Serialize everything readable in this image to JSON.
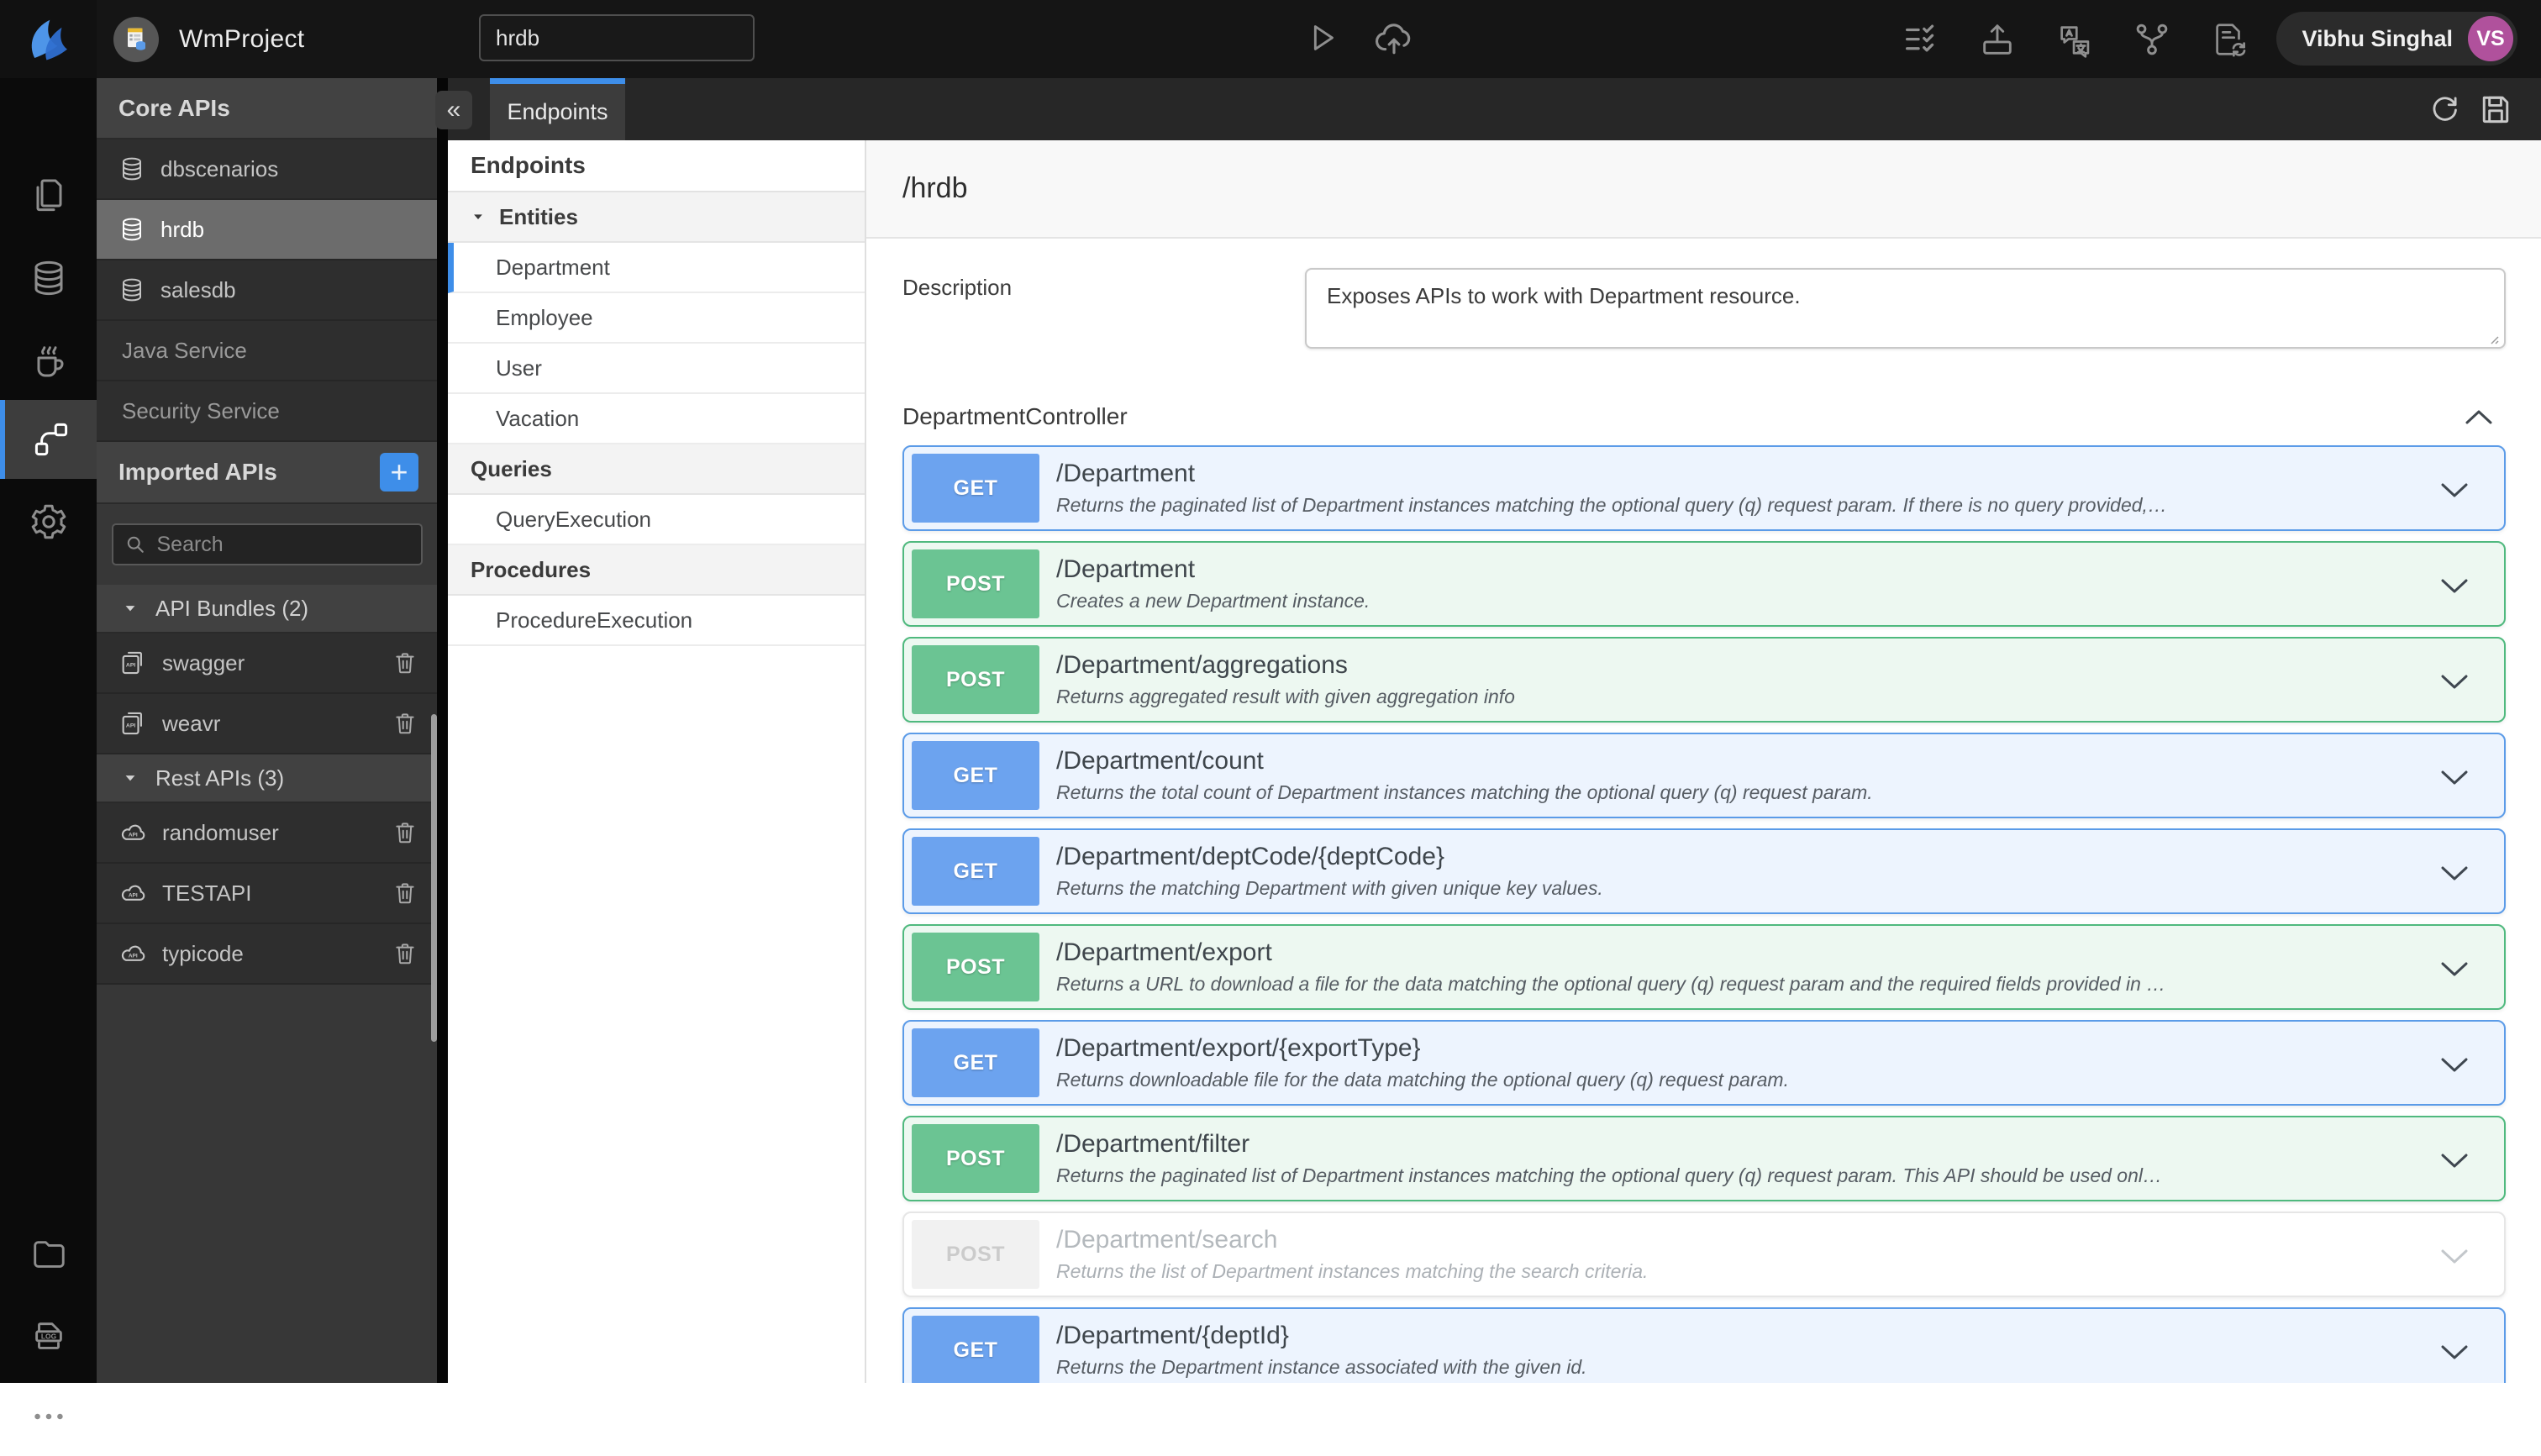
{
  "colors": {
    "accent": "#3E8EE9",
    "get_badge": "#6CA3EF",
    "get_bg": "#EDF4FE",
    "get_border": "#5B9BE8",
    "post_badge": "#6BC493",
    "post_bg": "#EDF8F1",
    "post_border": "#4FB97E",
    "disabled_badge_bg": "#F1F1F1",
    "disabled_badge_text": "#CBCBCB",
    "disabled_border": "#E6E6E6",
    "avatar_bg": "#B0519C"
  },
  "topbar": {
    "project_name": "WmProject",
    "search_value": "hrdb",
    "user_name": "Vibhu Singhal",
    "user_initials": "VS"
  },
  "rail": {
    "items": [
      {
        "icon": "pages-icon",
        "active": false
      },
      {
        "icon": "database-icon",
        "active": false
      },
      {
        "icon": "java-service-icon",
        "active": false
      },
      {
        "icon": "apis-icon",
        "active": true
      },
      {
        "icon": "settings-icon",
        "active": false
      }
    ],
    "bottom_items": [
      {
        "icon": "folder-icon"
      },
      {
        "icon": "logs-icon"
      },
      {
        "icon": "more-icon"
      }
    ]
  },
  "core_apis": {
    "title": "Core APIs",
    "collapse_glyph": "«",
    "items": [
      {
        "label": "dbscenarios",
        "icon": "db",
        "selected": false
      },
      {
        "label": "hrdb",
        "icon": "db",
        "selected": true
      },
      {
        "label": "salesdb",
        "icon": "db",
        "selected": false
      },
      {
        "label": "Java Service",
        "icon": "",
        "selected": false
      },
      {
        "label": "Security Service",
        "icon": "",
        "selected": false
      }
    ]
  },
  "imported_apis": {
    "title": "Imported APIs",
    "add_glyph": "+",
    "search_placeholder": "Search",
    "groups": [
      {
        "label": "API Bundles (2)",
        "icon": "api-doc",
        "items": [
          "swagger",
          "weavr"
        ]
      },
      {
        "label": "Rest APIs (3)",
        "icon": "api-cloud",
        "items": [
          "randomuser",
          "TESTAPI",
          "typicode"
        ]
      }
    ]
  },
  "workspace": {
    "tab_label": "Endpoints"
  },
  "tree": {
    "title": "Endpoints",
    "sections": [
      {
        "label": "Entities",
        "caret": true,
        "items": [
          {
            "label": "Department",
            "selected": true
          },
          {
            "label": "Employee",
            "selected": false
          },
          {
            "label": "User",
            "selected": false
          },
          {
            "label": "Vacation",
            "selected": false
          }
        ]
      },
      {
        "label": "Queries",
        "caret": false,
        "items": [
          {
            "label": "QueryExecution",
            "selected": false
          }
        ]
      },
      {
        "label": "Procedures",
        "caret": false,
        "items": [
          {
            "label": "ProcedureExecution",
            "selected": false
          }
        ]
      }
    ]
  },
  "main": {
    "title": "/hrdb",
    "description_label": "Description",
    "description_value": "Exposes APIs to work with Department resource.",
    "controller_name": "DepartmentController",
    "endpoints": [
      {
        "method": "GET",
        "path": "/Department",
        "description": "Returns the paginated list of Department instances matching the optional query (q) request param. If there is no query provided,…",
        "disabled": false
      },
      {
        "method": "POST",
        "path": "/Department",
        "description": "Creates a new Department instance.",
        "disabled": false
      },
      {
        "method": "POST",
        "path": "/Department/aggregations",
        "description": "Returns aggregated result with given aggregation info",
        "disabled": false
      },
      {
        "method": "GET",
        "path": "/Department/count",
        "description": "Returns the total count of Department instances matching the optional query (q) request param.",
        "disabled": false
      },
      {
        "method": "GET",
        "path": "/Department/deptCode/{deptCode}",
        "description": "Returns the matching Department with given unique key values.",
        "disabled": false
      },
      {
        "method": "POST",
        "path": "/Department/export",
        "description": "Returns a URL to download a file for the data matching the optional query (q) request param and the required fields provided in …",
        "disabled": false
      },
      {
        "method": "GET",
        "path": "/Department/export/{exportType}",
        "description": "Returns downloadable file for the data matching the optional query (q) request param.",
        "disabled": false
      },
      {
        "method": "POST",
        "path": "/Department/filter",
        "description": "Returns the paginated list of Department instances matching the optional query (q) request param. This API should be used onl…",
        "disabled": false
      },
      {
        "method": "POST",
        "path": "/Department/search",
        "description": "Returns the list of Department instances matching the search criteria.",
        "disabled": true
      },
      {
        "method": "GET",
        "path": "/Department/{deptId}",
        "description": "Returns the Department instance associated with the given id.",
        "disabled": false
      }
    ]
  }
}
